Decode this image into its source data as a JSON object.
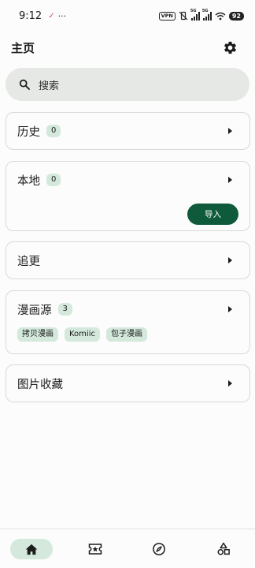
{
  "status_bar": {
    "time": "9:12",
    "notification_glyph": "✓",
    "more": "···",
    "vpn": "VPN",
    "sig1_label": "5G",
    "sig2_label": "5G",
    "battery": "92"
  },
  "header": {
    "title": "主页"
  },
  "search": {
    "placeholder": "搜索"
  },
  "cards": {
    "history": {
      "label": "历史",
      "count": "0"
    },
    "local": {
      "label": "本地",
      "count": "0",
      "import_label": "导入"
    },
    "following": {
      "label": "追更"
    },
    "sources": {
      "label": "漫画源",
      "count": "3",
      "chips": [
        "拷贝漫画",
        "Komiic",
        "包子漫画"
      ]
    },
    "favorites": {
      "label": "图片收藏"
    }
  },
  "bottom_nav": {
    "items": [
      "home-icon",
      "ticket-star-icon",
      "compass-icon",
      "shapes-icon"
    ],
    "active": "home-icon"
  },
  "colors": {
    "accent": "#0e5a3a",
    "chip": "#d4e8dc",
    "search_bg": "#e5e8e4"
  }
}
